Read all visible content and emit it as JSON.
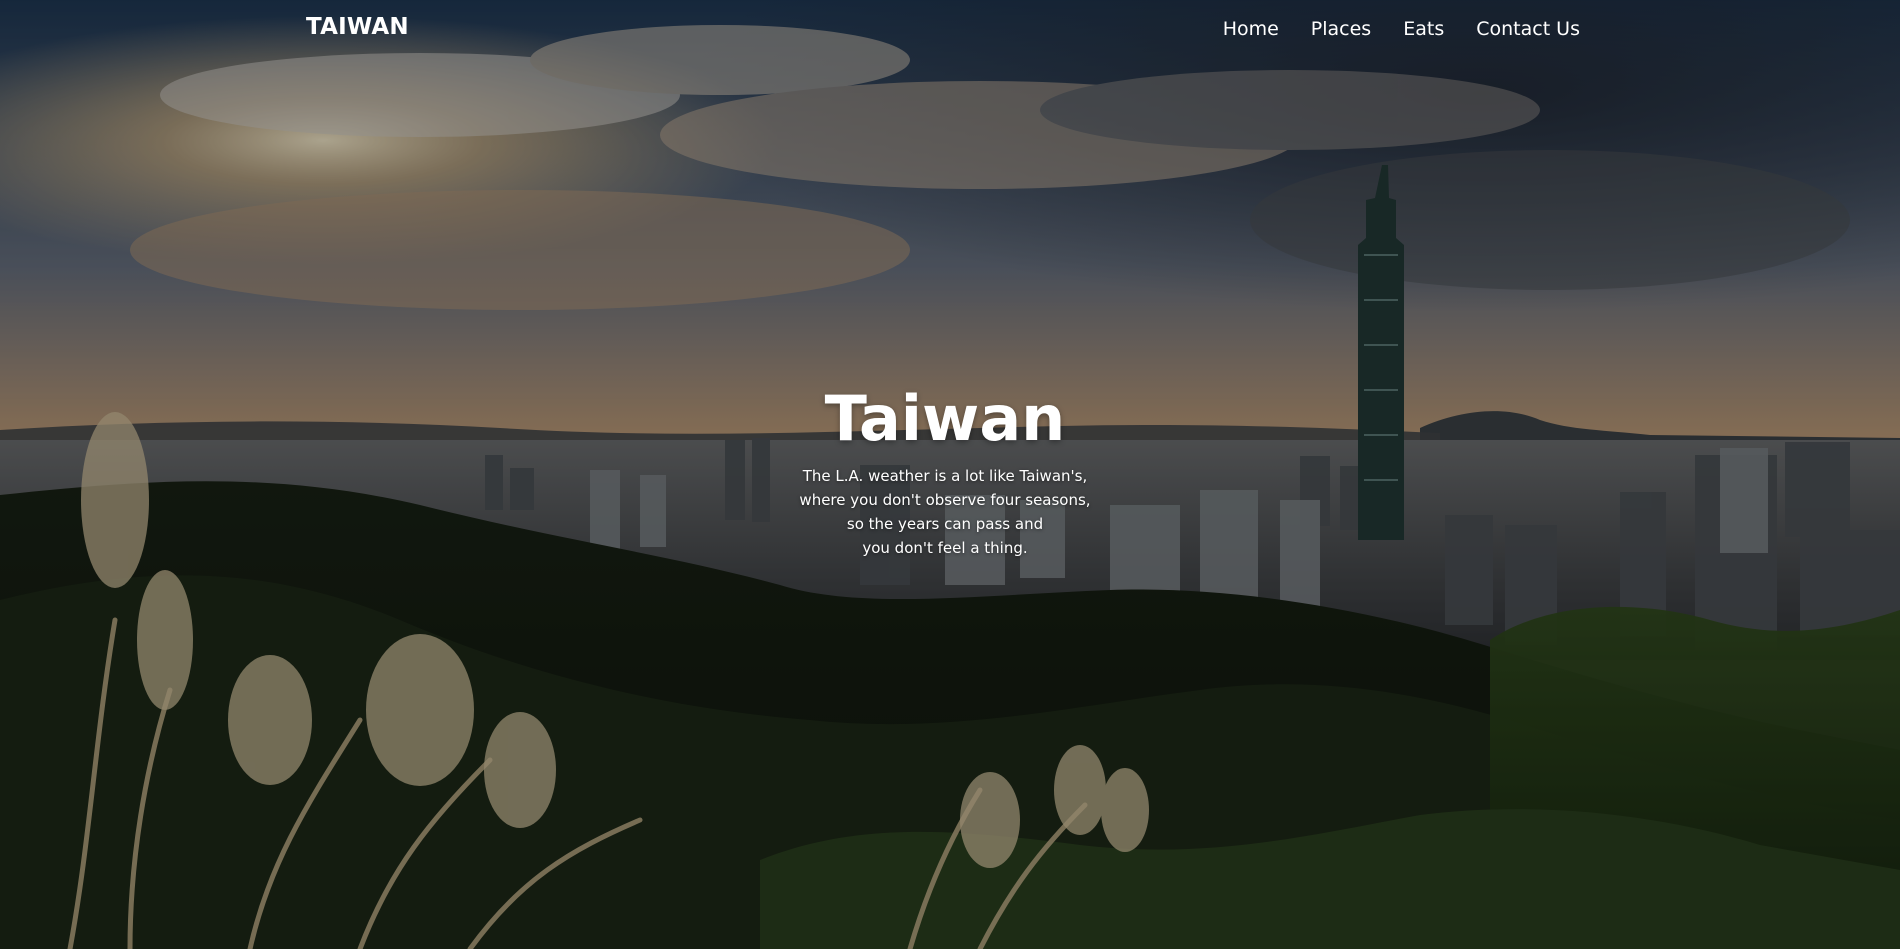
{
  "navbar": {
    "brand": "TAIWAN",
    "links": [
      "Home",
      "Places",
      "Eats",
      "Contact Us"
    ]
  },
  "hero": {
    "title": "Taiwan",
    "quote_lines": [
      "The L.A. weather is a lot like Taiwan's,",
      "where you don't observe four seasons,",
      "so the years can pass and",
      "you don't feel a thing."
    ]
  },
  "colors": {
    "text": "#ffffff",
    "sky_top": "#2c4158",
    "sky_glow": "#d8b486",
    "foliage": "#243418"
  }
}
